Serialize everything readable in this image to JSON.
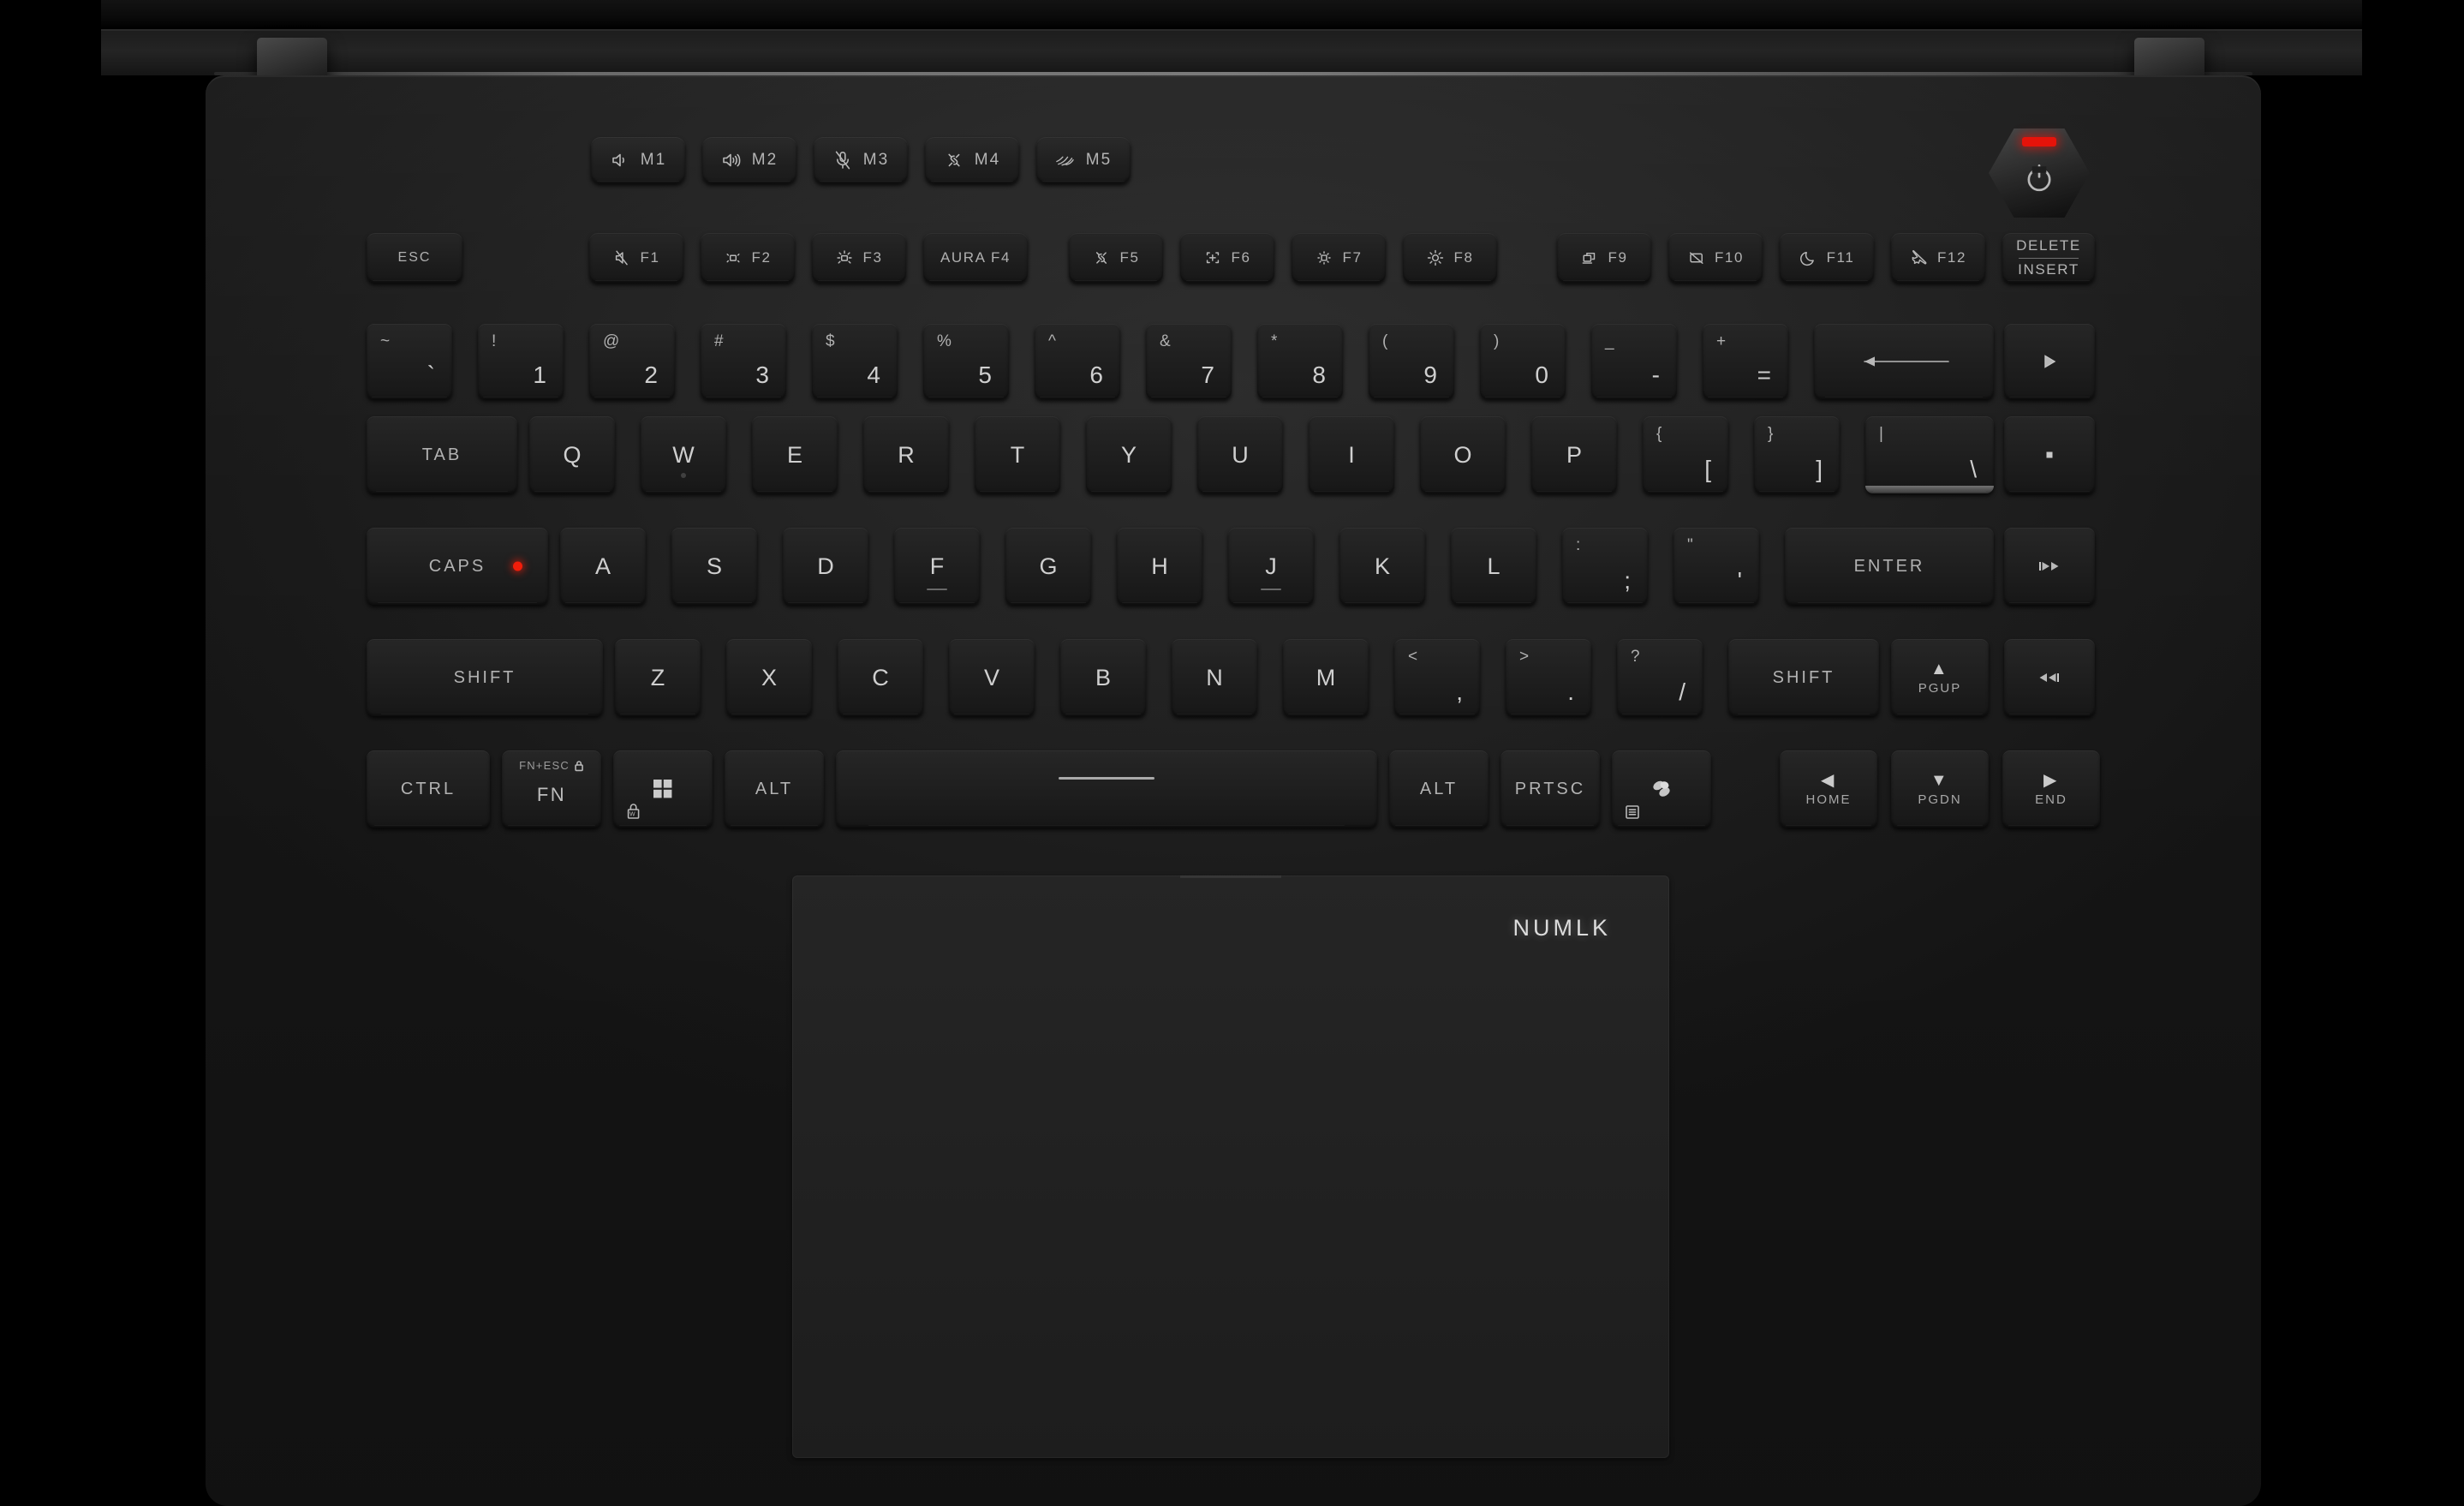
{
  "device": {
    "brand": "ROG",
    "accent_red": "#e5130a",
    "key_text_color": "#cfcfcf",
    "deck_color": "#232323"
  },
  "power_button": {
    "name": "power",
    "icon": "power-icon",
    "led_color": "#e5130a"
  },
  "macro_row": [
    {
      "label": "M1",
      "icon": "volume-down-icon"
    },
    {
      "label": "M2",
      "icon": "volume-up-icon"
    },
    {
      "label": "M3",
      "icon": "microphone-mute-icon"
    },
    {
      "label": "M4",
      "icon": "fan-performance-icon"
    },
    {
      "label": "M5",
      "icon": "rog-logo-icon"
    }
  ],
  "function_row": [
    {
      "label": "ESC",
      "icon": ""
    },
    {
      "label": "F1",
      "icon": "speaker-mute-icon"
    },
    {
      "label": "F2",
      "icon": "keyboard-backlight-down-icon"
    },
    {
      "label": "F3",
      "icon": "keyboard-backlight-up-icon"
    },
    {
      "label": "AURA F4",
      "icon": ""
    },
    {
      "label": "F5",
      "icon": "fan-performance-icon"
    },
    {
      "label": "F6",
      "icon": "screen-snip-icon"
    },
    {
      "label": "F7",
      "icon": "brightness-down-icon"
    },
    {
      "label": "F8",
      "icon": "brightness-up-icon"
    },
    {
      "label": "F9",
      "icon": "display-switch-icon"
    },
    {
      "label": "F10",
      "icon": "touchpad-toggle-icon"
    },
    {
      "label": "F11",
      "icon": "sleep-moon-icon"
    },
    {
      "label": "F12",
      "icon": "airplane-mode-icon"
    },
    {
      "line1": "DELETE",
      "line2": "INSERT",
      "icon": ""
    }
  ],
  "number_row": [
    {
      "top": "~",
      "bottom": "`"
    },
    {
      "top": "!",
      "bottom": "1"
    },
    {
      "top": "@",
      "bottom": "2"
    },
    {
      "top": "#",
      "bottom": "3"
    },
    {
      "top": "$",
      "bottom": "4"
    },
    {
      "top": "%",
      "bottom": "5"
    },
    {
      "top": "^",
      "bottom": "6"
    },
    {
      "top": "&",
      "bottom": "7"
    },
    {
      "top": "*",
      "bottom": "8"
    },
    {
      "top": "(",
      "bottom": "9"
    },
    {
      "top": ")",
      "bottom": "0"
    },
    {
      "top": "_",
      "bottom": "-"
    },
    {
      "top": "+",
      "bottom": "="
    }
  ],
  "backspace": {
    "icon": "backspace-long-arrow-icon"
  },
  "qwerty_row": [
    {
      "label": "TAB",
      "style": "word"
    },
    {
      "label": "Q",
      "style": "letter"
    },
    {
      "label": "W",
      "style": "letter",
      "homing_dot": true
    },
    {
      "label": "E",
      "style": "letter"
    },
    {
      "label": "R",
      "style": "letter"
    },
    {
      "label": "T",
      "style": "letter"
    },
    {
      "label": "Y",
      "style": "letter"
    },
    {
      "label": "U",
      "style": "letter"
    },
    {
      "label": "I",
      "style": "letter"
    },
    {
      "label": "O",
      "style": "letter"
    },
    {
      "label": "P",
      "style": "letter"
    },
    {
      "top": "{",
      "bottom": "["
    },
    {
      "top": "}",
      "bottom": "]"
    },
    {
      "top": "|",
      "bottom": "\\",
      "lit": true
    }
  ],
  "home_row": [
    {
      "label": "CAPS",
      "style": "word",
      "led": true
    },
    {
      "label": "A",
      "style": "letter"
    },
    {
      "label": "S",
      "style": "letter"
    },
    {
      "label": "D",
      "style": "letter"
    },
    {
      "label": "F",
      "style": "letter",
      "homing": true
    },
    {
      "label": "G",
      "style": "letter"
    },
    {
      "label": "H",
      "style": "letter"
    },
    {
      "label": "J",
      "style": "letter",
      "homing": true
    },
    {
      "label": "K",
      "style": "letter"
    },
    {
      "label": "L",
      "style": "letter"
    },
    {
      "top": ":",
      "bottom": ";"
    },
    {
      "top": "\"",
      "bottom": "'"
    },
    {
      "label": "ENTER",
      "style": "word"
    }
  ],
  "shift_row": [
    {
      "label": "SHIFT",
      "style": "word"
    },
    {
      "label": "Z",
      "style": "letter"
    },
    {
      "label": "X",
      "style": "letter"
    },
    {
      "label": "C",
      "style": "letter"
    },
    {
      "label": "V",
      "style": "letter"
    },
    {
      "label": "B",
      "style": "letter"
    },
    {
      "label": "N",
      "style": "letter"
    },
    {
      "label": "M",
      "style": "letter"
    },
    {
      "top": "<",
      "bottom": ","
    },
    {
      "top": ">",
      "bottom": "."
    },
    {
      "top": "?",
      "bottom": "/"
    },
    {
      "label": "SHIFT",
      "style": "word"
    }
  ],
  "bottom_row": {
    "ctrl": "CTRL",
    "fn": {
      "main": "FN",
      "top": "FN+ESC",
      "top_icon": "lock-icon"
    },
    "windows": {
      "icon": "windows-logo-icon",
      "sub_icon": "windows-lock-icon"
    },
    "alt_left": "ALT",
    "space": {
      "icon": "spacebar-marker"
    },
    "alt_right": "ALT",
    "prtsc": "PRTSC",
    "copilot": {
      "icon": "copilot-icon",
      "sub_icon": "menu-list-icon"
    }
  },
  "nav_cluster": {
    "up": {
      "glyph": "▲",
      "label": "PGUP"
    },
    "left": {
      "glyph": "◀",
      "label": "HOME"
    },
    "down": {
      "glyph": "▼",
      "label": "PGDN"
    },
    "right": {
      "glyph": "▶",
      "label": "END"
    }
  },
  "media_column": [
    {
      "icon": "play-pause-icon",
      "name": "play-pause"
    },
    {
      "icon": "stop-icon",
      "name": "stop"
    },
    {
      "icon": "previous-track-icon",
      "name": "previous-track"
    },
    {
      "icon": "next-track-icon",
      "name": "next-track"
    }
  ],
  "trackpad": {
    "numlk_label": "NUMLK"
  }
}
